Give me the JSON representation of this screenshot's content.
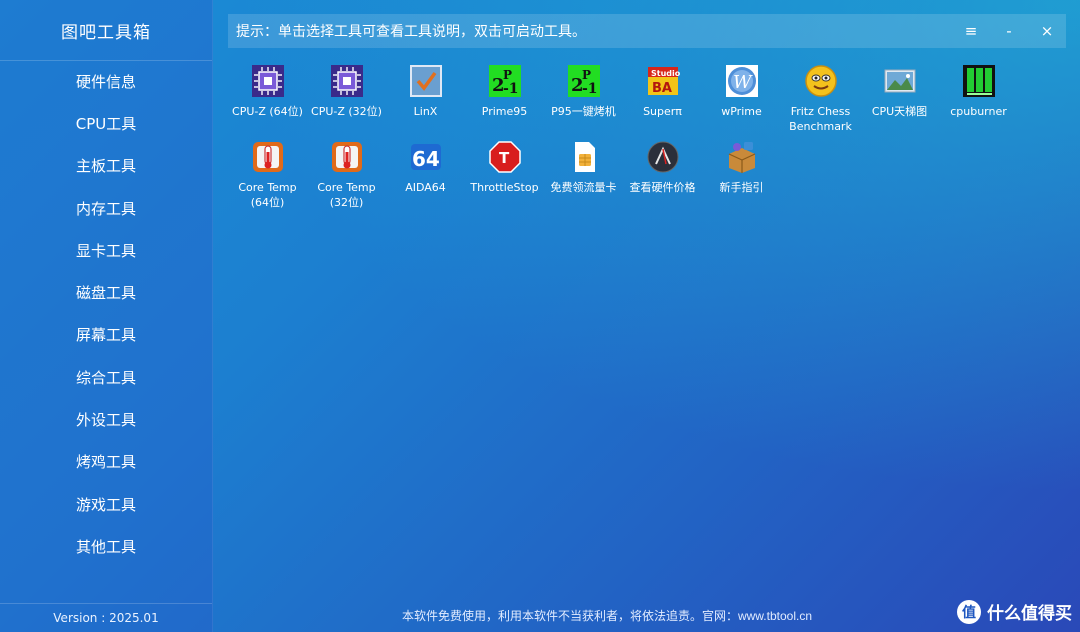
{
  "app": {
    "title": "图吧工具箱",
    "version": "Version : 2025.01"
  },
  "sidebar": {
    "items": [
      {
        "label": "硬件信息"
      },
      {
        "label": "CPU工具"
      },
      {
        "label": "主板工具"
      },
      {
        "label": "内存工具"
      },
      {
        "label": "显卡工具"
      },
      {
        "label": "磁盘工具"
      },
      {
        "label": "屏幕工具"
      },
      {
        "label": "综合工具"
      },
      {
        "label": "外设工具"
      },
      {
        "label": "烤鸡工具"
      },
      {
        "label": "游戏工具"
      },
      {
        "label": "其他工具"
      }
    ]
  },
  "hint": {
    "text": "提示：单击选择工具可查看工具说明，双击可启动工具。"
  },
  "window_controls": {
    "menu": "≡",
    "minimize": "-",
    "close": "×"
  },
  "tools": [
    {
      "label": "CPU-Z (64位)",
      "icon": "cpuz-icon"
    },
    {
      "label": "CPU-Z (32位)",
      "icon": "cpuz-icon"
    },
    {
      "label": "LinX",
      "icon": "linx-icon"
    },
    {
      "label": "Prime95",
      "icon": "prime95-icon"
    },
    {
      "label": "P95一键烤机",
      "icon": "prime95-icon"
    },
    {
      "label": "Superπ",
      "icon": "superpi-icon"
    },
    {
      "label": "wPrime",
      "icon": "wprime-icon"
    },
    {
      "label": "Fritz Chess\nBenchmark",
      "icon": "fritz-icon"
    },
    {
      "label": "CPU天梯图",
      "icon": "ladder-icon"
    },
    {
      "label": "cpuburner",
      "icon": "cpuburner-icon"
    },
    {
      "label": "Core Temp\n(64位)",
      "icon": "coretemp-icon"
    },
    {
      "label": "Core Temp\n(32位)",
      "icon": "coretemp-icon"
    },
    {
      "label": "AIDA64",
      "icon": "aida64-icon"
    },
    {
      "label": "ThrottleStop",
      "icon": "throttlestop-icon"
    },
    {
      "label": "免费领流量卡",
      "icon": "simcard-icon"
    },
    {
      "label": "查看硬件价格",
      "icon": "price-icon"
    },
    {
      "label": "新手指引",
      "icon": "guide-icon"
    }
  ],
  "footer": {
    "text": "本软件免费使用，利用本软件不当获利者，将依法追责。官网：www.tbtool.cn"
  },
  "watermark": {
    "badge": "值",
    "text": "什么值得买"
  }
}
